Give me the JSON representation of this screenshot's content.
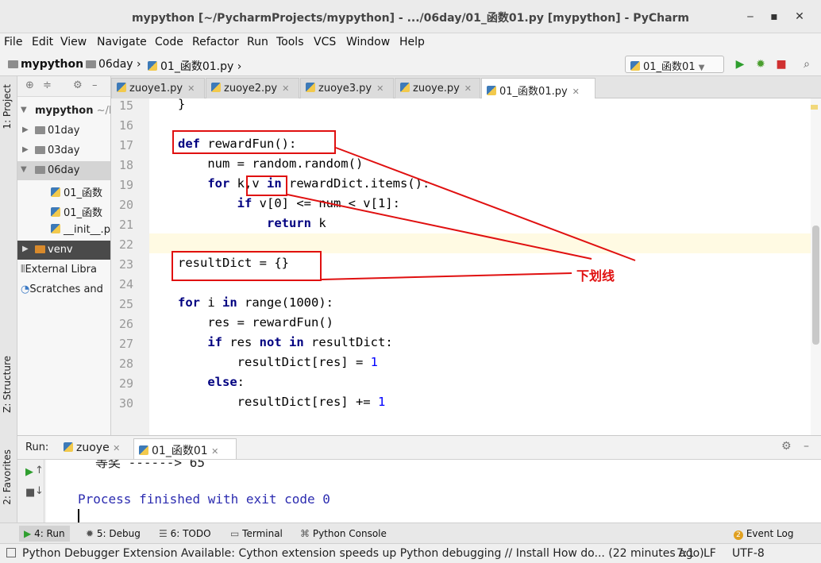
{
  "window": {
    "title": "mypython [~/PycharmProjects/mypython] - .../06day/01_函数01.py [mypython] - PyCharm",
    "minimize": "‒",
    "maximize": "▪",
    "close": "✕"
  },
  "menu": [
    "File",
    "Edit",
    "View",
    "Navigate",
    "Code",
    "Refactor",
    "Run",
    "Tools",
    "VCS",
    "Window",
    "Help"
  ],
  "breadcrumb": [
    "mypython",
    "06day",
    "01_函数01.py"
  ],
  "run_config": "01_函数01",
  "side_tabs": {
    "project": "1: Project",
    "structure": "Z: Structure",
    "favorites": "2: Favorites"
  },
  "project": {
    "root": "mypython",
    "root_path": "~/P",
    "items": [
      {
        "label": "01day"
      },
      {
        "label": "03day"
      },
      {
        "label": "06day"
      },
      {
        "label": "01_函数"
      },
      {
        "label": "01_函数"
      },
      {
        "label": "__init__.p"
      },
      {
        "label": "venv"
      },
      {
        "label": "External Libra"
      },
      {
        "label": "Scratches and"
      }
    ]
  },
  "tabs": [
    "zuoye1.py",
    "zuoye2.py",
    "zuoye3.py",
    "zuoye.py",
    "01_函数01.py"
  ],
  "editor": {
    "line_numbers": [
      "15",
      "16",
      "17",
      "18",
      "19",
      "20",
      "21",
      "22",
      "23",
      "24",
      "25",
      "26",
      "27",
      "28",
      "29",
      "30"
    ],
    "first_line": "}",
    "annotation": "下划线"
  },
  "code": {
    "l17_kw": "def",
    "l17_rest": " rewardFun():",
    "l18": "    num = random.random()",
    "l19_kw1": "for",
    "l19_mid": " k,v ",
    "l19_kw2": "in",
    "l19_rest": " rewardDict.items():",
    "l20_kw": "if",
    "l20_rest": " v[0] <= num < v[1]:",
    "l21_kw": "return",
    "l21_rest": " k",
    "l23": "resultDict = {}",
    "l25_kw1": "for",
    "l25_mid": " i ",
    "l25_kw2": "in",
    "l25_rest": " range(1000):",
    "l26": "    res = rewardFun()",
    "l27_kw1": "if",
    "l27_mid": " res ",
    "l27_kw2": "not in",
    "l27_rest": " resultDict:",
    "l28_pre": "        resultDict[res] = ",
    "l28_num": "1",
    "l29_kw": "else",
    "l29_rest": ":",
    "l30_pre": "        resultDict[res] += ",
    "l30_num": "1"
  },
  "run": {
    "label": "Run:",
    "tabs": [
      "zuoye",
      "01_函数01"
    ],
    "console_partial": "等奖 ------> 65",
    "console_line": "Process finished with exit code 0"
  },
  "bottom_tools": [
    "4: Run",
    "5: Debug",
    "6: TODO",
    "Terminal",
    "Python Console",
    "Event Log"
  ],
  "event_count": "2",
  "status": {
    "message": "Python Debugger Extension Available: Cython extension speeds up Python debugging // Install How do... (22 minutes ago)",
    "position": "7:1",
    "line_sep": "LF",
    "encoding": "UTF-8"
  }
}
